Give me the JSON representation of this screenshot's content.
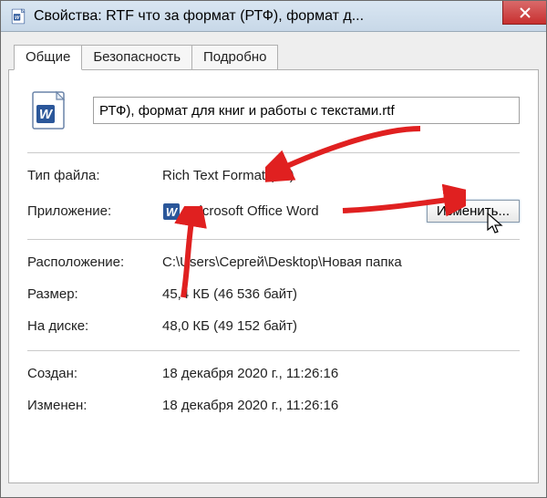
{
  "window": {
    "title": "Свойства: RTF что за формат (РТФ), формат д..."
  },
  "tabs": {
    "general": "Общие",
    "security": "Безопасность",
    "details": "Подробно"
  },
  "file": {
    "name": "РТФ), формат для книг и работы с текстами.rtf"
  },
  "labels": {
    "filetype": "Тип файла:",
    "application": "Приложение:",
    "location": "Расположение:",
    "size": "Размер:",
    "size_on_disk": "На диске:",
    "created": "Создан:",
    "modified": "Изменен:",
    "change_btn": "Изменить..."
  },
  "values": {
    "filetype": "Rich Text Format (.rtf)",
    "application": "Microsoft Office Word",
    "location": "C:\\Users\\Сергей\\Desktop\\Новая папка",
    "size": "45,4 КБ (46 536 байт)",
    "size_on_disk": "48,0 КБ (49 152 байт)",
    "created": "18 декабря 2020 г., 11:26:16",
    "modified": "18 декабря 2020 г., 11:26:16"
  }
}
